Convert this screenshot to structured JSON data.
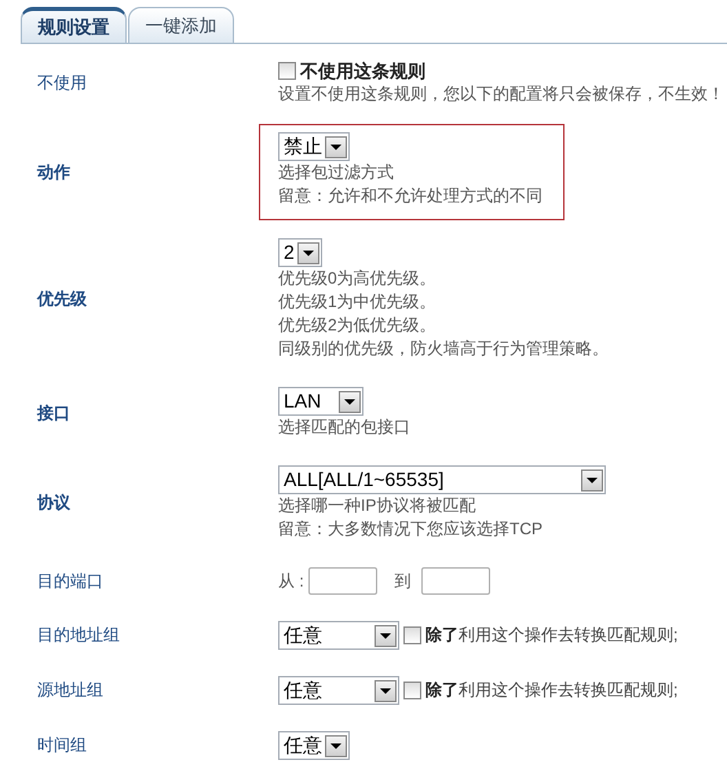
{
  "tabs": [
    {
      "label": "规则设置",
      "selected": true
    },
    {
      "label": "一键添加",
      "selected": false
    }
  ],
  "rows": [
    {
      "label": "不使用",
      "bold": false,
      "kind": "checkbox",
      "highlighted": false,
      "option": "不使用这条规则",
      "checked": false,
      "hints": [
        "设置不使用这条规则，您以下的配置将只会被保存，不生效！"
      ]
    },
    {
      "label": "动作",
      "bold": true,
      "kind": "select",
      "highlighted": true,
      "value": "禁止",
      "hints": [
        "选择包过滤方式",
        "留意：允许和不允许处理方式的不同"
      ]
    },
    {
      "label": "优先级",
      "bold": true,
      "kind": "select",
      "highlighted": false,
      "value": "2",
      "hints": [
        "优先级0为高优先级。",
        "优先级1为中优先级。",
        "优先级2为低优先级。",
        "同级别的优先级，防火墙高于行为管理策略。"
      ]
    },
    {
      "label": "接口",
      "bold": true,
      "kind": "select",
      "highlighted": false,
      "value": "LAN",
      "hints": [
        "选择匹配的包接口"
      ]
    },
    {
      "label": "协议",
      "bold": true,
      "kind": "select",
      "highlighted": false,
      "value": "ALL[ALL/1~65535]",
      "hints": [
        "选择哪一种IP协议将被匹配",
        "留意：大多数情况下您应该选择TCP"
      ]
    },
    {
      "label": "目的端口",
      "bold": false,
      "kind": "range",
      "highlighted": false,
      "from_label": "从 :",
      "to_label": "到"
    },
    {
      "label": "目的地址组",
      "bold": false,
      "kind": "select-except",
      "highlighted": false,
      "value": "任意",
      "checked": false,
      "except_text": "**除了**利用这个操作去转换匹配规则;"
    },
    {
      "label": "源地址组",
      "bold": false,
      "kind": "select-except",
      "highlighted": false,
      "value": "任意",
      "checked": false,
      "except_text": "**除了**利用这个操作去转换匹配规则;"
    },
    {
      "label": "时间组",
      "bold": false,
      "kind": "select",
      "highlighted": false,
      "value": "任意"
    }
  ]
}
